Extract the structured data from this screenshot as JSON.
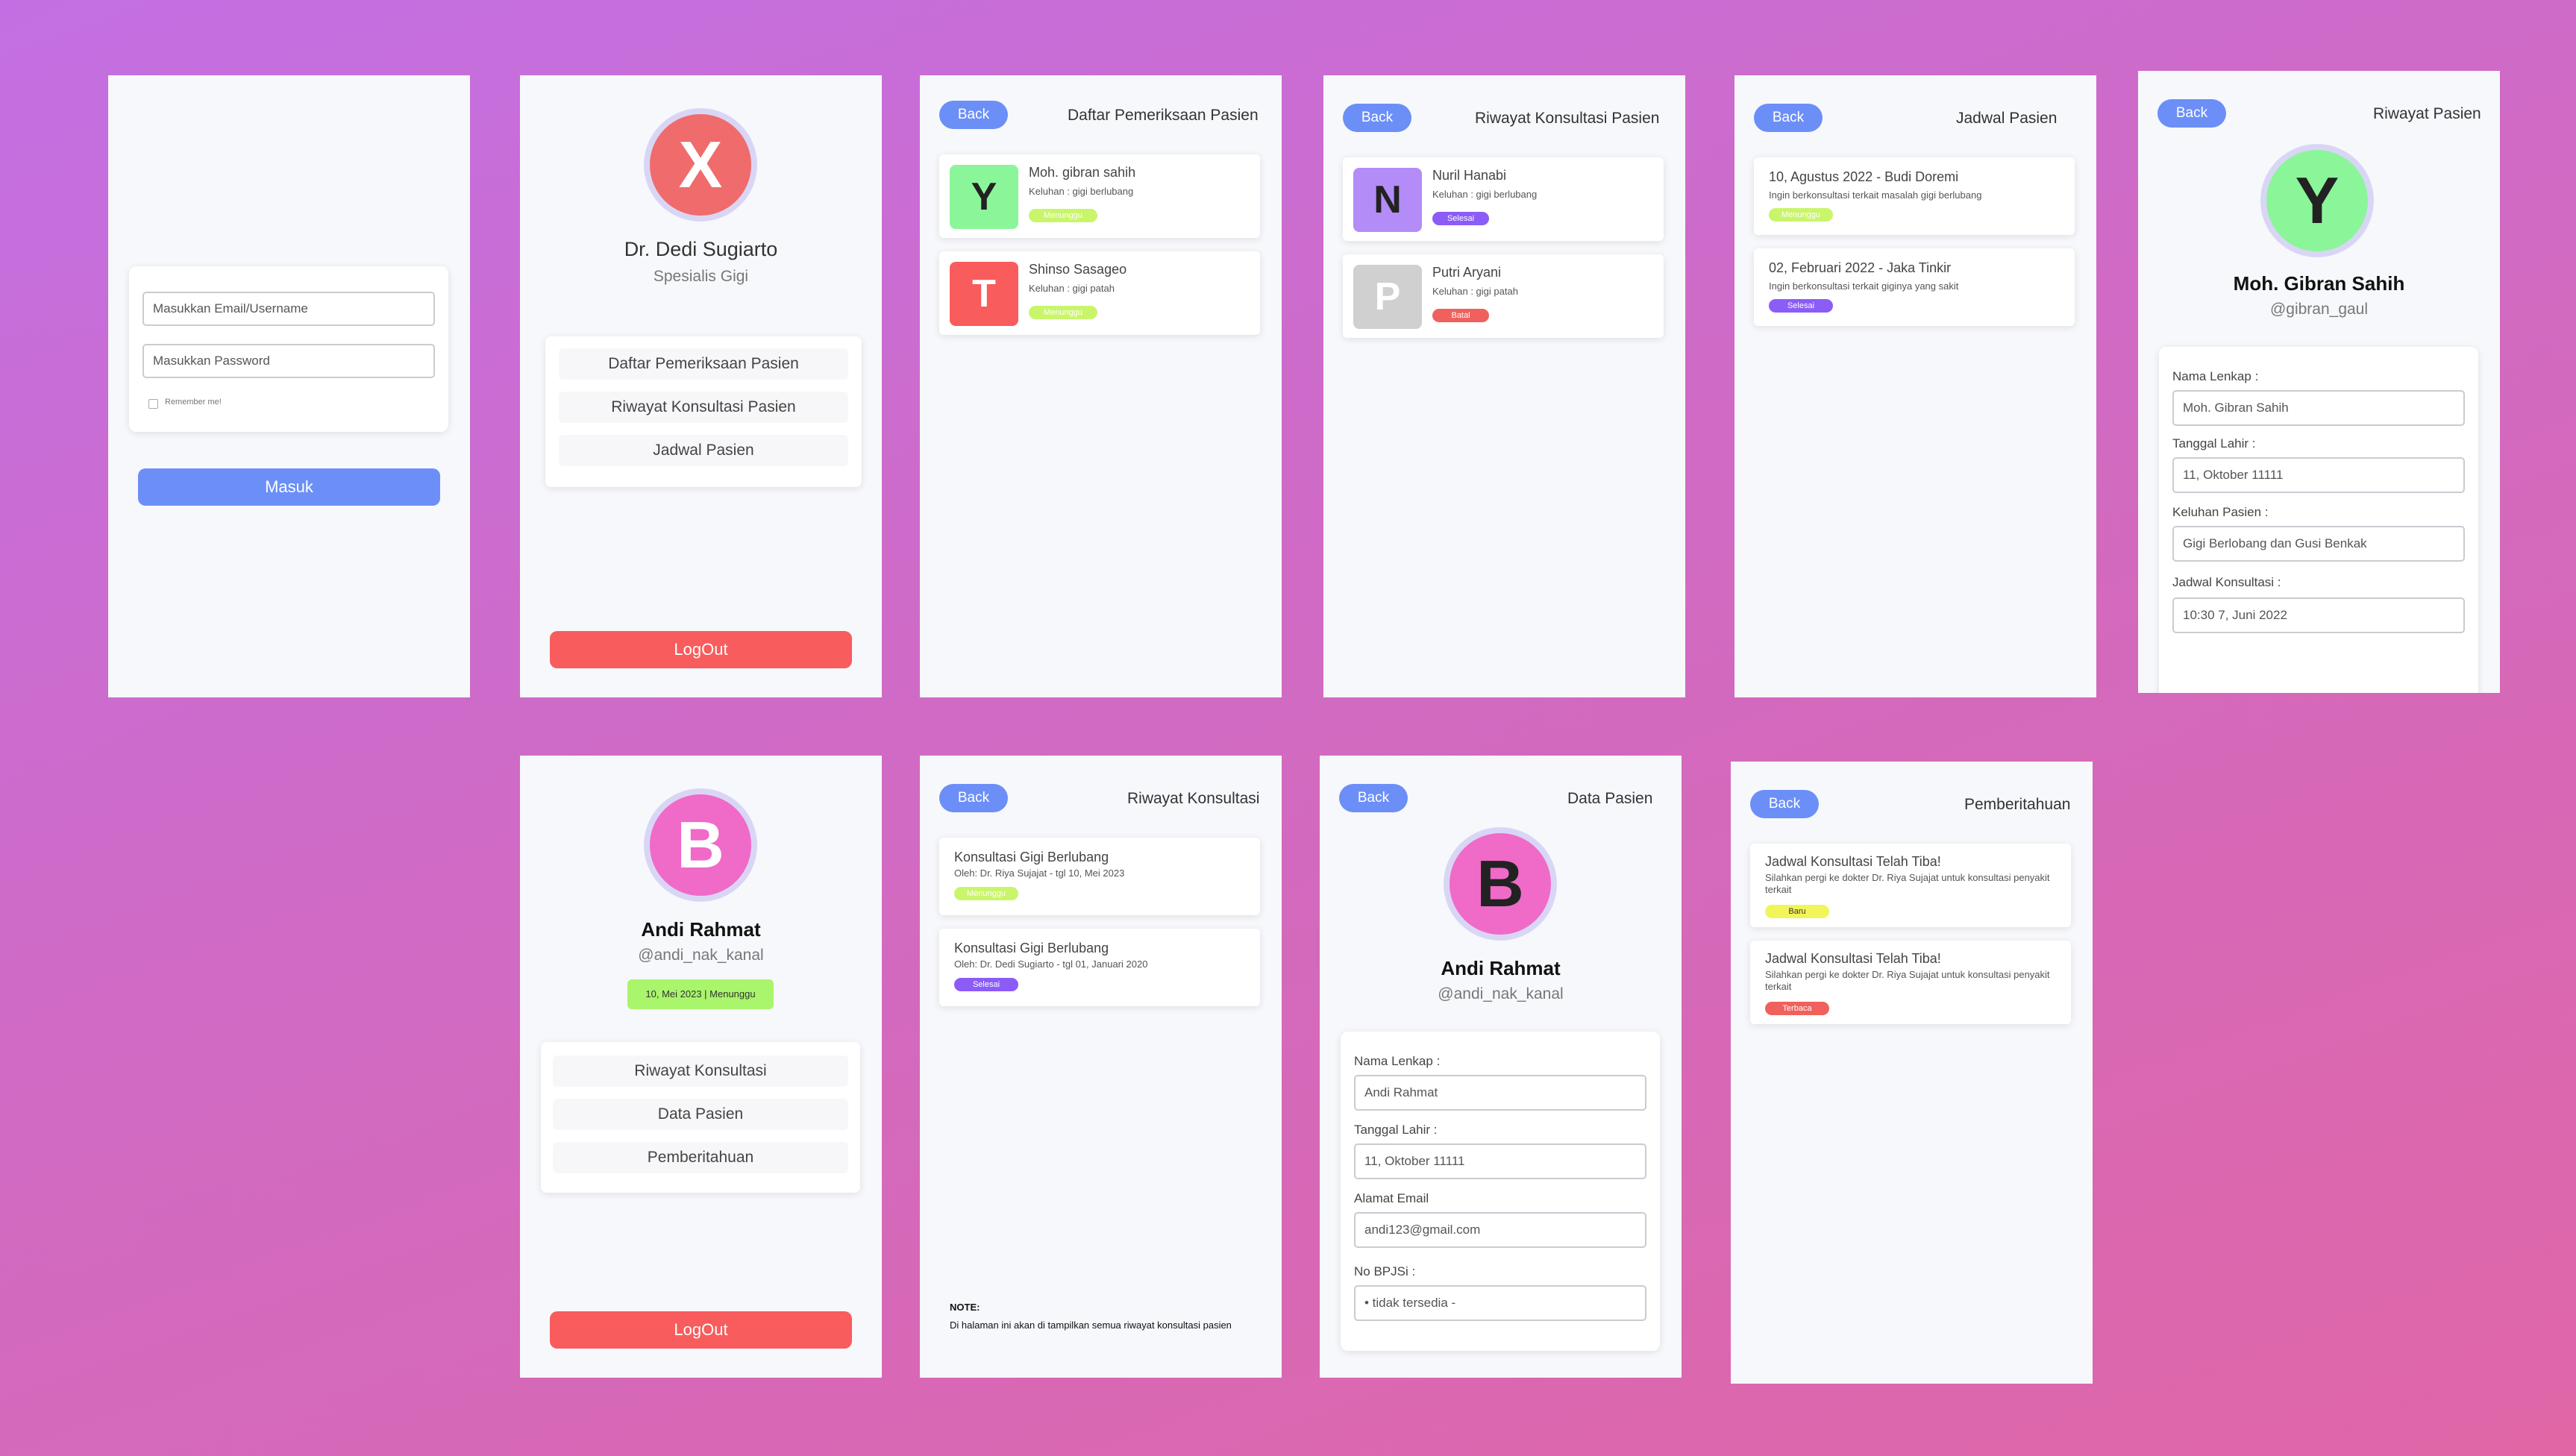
{
  "login": {
    "email_placeholder": "Masukkan Email/Username",
    "password_placeholder": "Masukkan Password",
    "remember": "Remember me!",
    "submit": "Masuk"
  },
  "doctor_home": {
    "avatar_letter": "X",
    "name": "Dr. Dedi Sugiarto",
    "role": "Spesialis Gigi",
    "menu": [
      "Daftar Pemeriksaan Pasien",
      "Riwayat Konsultasi Pasien",
      "Jadwal Pasien"
    ],
    "logout": "LogOut"
  },
  "exam_list": {
    "back": "Back",
    "title": "Daftar Pemeriksaan Pasien",
    "items": [
      {
        "letter": "Y",
        "name": "Moh. gibran sahih",
        "complaint": "Keluhan : gigi berlubang",
        "status": "Menunggu",
        "color": "#8bf59a",
        "badge_color": "#c9f56b"
      },
      {
        "letter": "T",
        "name": "Shinso Sasageo",
        "complaint": "Keluhan : gigi patah",
        "status": "Menunggu",
        "color": "#f85c5c",
        "badge_color": "#c9f56b"
      }
    ]
  },
  "consult_history": {
    "back": "Back",
    "title": "Riwayat Konsultasi Pasien",
    "items": [
      {
        "letter": "N",
        "name": "Nuril Hanabi",
        "complaint": "Keluhan : gigi berlubang",
        "status": "Selesai",
        "color": "#b38cf7",
        "badge_color": "#8b5cf6"
      },
      {
        "letter": "P",
        "name": "Putri Aryani",
        "complaint": "Keluhan : gigi patah",
        "status": "Batal",
        "color": "#d0d0d0",
        "badge_color": "#f0605d"
      }
    ]
  },
  "schedule": {
    "back": "Back",
    "title": "Jadwal Pasien",
    "items": [
      {
        "title": "10, Agustus 2022 - Budi Doremi",
        "desc": "Ingin berkonsultasi terkait masalah gigi berlubang",
        "status": "Menunggu",
        "badge_color": "#c9f56b"
      },
      {
        "title": "02, Februari 2022 - Jaka Tinkir",
        "desc": "Ingin berkonsultasi terkait giginya yang sakit",
        "status": "Selesai",
        "badge_color": "#8b5cf6"
      }
    ]
  },
  "patient_history": {
    "back": "Back",
    "title": "Riwayat Pasien",
    "avatar_letter": "Y",
    "name": "Moh. Gibran Sahih",
    "handle": "@gibran_gaul",
    "fields": [
      {
        "label": "Nama Lenkap :",
        "value": "Moh. Gibran Sahih"
      },
      {
        "label": "Tanggal Lahir :",
        "value": "11, Oktober 11111"
      },
      {
        "label": "Keluhan Pasien :",
        "value": "Gigi Berlobang dan Gusi Benkak"
      },
      {
        "label": "Jadwal Konsultasi :",
        "value": "10:30 7, Juni 2022"
      }
    ]
  },
  "patient_home": {
    "avatar_letter": "B",
    "name": "Andi Rahmat",
    "handle": "@andi_nak_kanal",
    "status_pill": "10, Mei 2023 | Menunggu",
    "menu": [
      "Riwayat Konsultasi",
      "Data Pasien",
      "Pemberitahuan"
    ],
    "logout": "LogOut"
  },
  "patient_consult": {
    "back": "Back",
    "title": "Riwayat Konsultasi",
    "items": [
      {
        "title": "Konsultasi Gigi Berlubang",
        "desc": "Oleh: Dr. Riya Sujajat - tgl 10, Mei 2023",
        "status": "Menunggu",
        "badge_color": "#c9f56b"
      },
      {
        "title": "Konsultasi Gigi Berlubang",
        "desc": "Oleh: Dr. Dedi Sugiarto - tgl 01, Januari 2020",
        "status": "Selesai",
        "badge_color": "#8b5cf6"
      }
    ],
    "note_title": "NOTE:",
    "note_body": "Di halaman ini akan di tampilkan semua riwayat konsultasi pasien"
  },
  "patient_data": {
    "back": "Back",
    "title": "Data Pasien",
    "avatar_letter": "B",
    "name": "Andi Rahmat",
    "handle": "@andi_nak_kanal",
    "fields": [
      {
        "label": "Nama Lenkap :",
        "value": "Andi Rahmat"
      },
      {
        "label": "Tanggal Lahir :",
        "value": "11, Oktober 11111"
      },
      {
        "label": "Alamat Email",
        "value": "andi123@gmail.com"
      },
      {
        "label": "No BPJSi :",
        "value": "•  tidak tersedia -"
      }
    ]
  },
  "notifications": {
    "back": "Back",
    "title": "Pemberitahuan",
    "items": [
      {
        "title": "Jadwal Konsultasi Telah Tiba!",
        "desc": "Silahkan pergi ke dokter Dr. Riya Sujajat untuk konsultasi penyakit terkait",
        "status": "Baru",
        "badge_color": "#f2f55a"
      },
      {
        "title": "Jadwal Konsultasi Telah Tiba!",
        "desc": "Silahkan pergi ke dokter Dr. Riya Sujajat untuk konsultasi penyakit terkait",
        "status": "Terbaca",
        "badge_color": "#f0605d"
      }
    ]
  },
  "colors": {
    "accent": "#6b8ff7",
    "danger": "#f85c5c",
    "red_avatar": "#f06b6b",
    "pink_avatar": "#f06ac8",
    "green_avatar": "#8bf59a"
  }
}
